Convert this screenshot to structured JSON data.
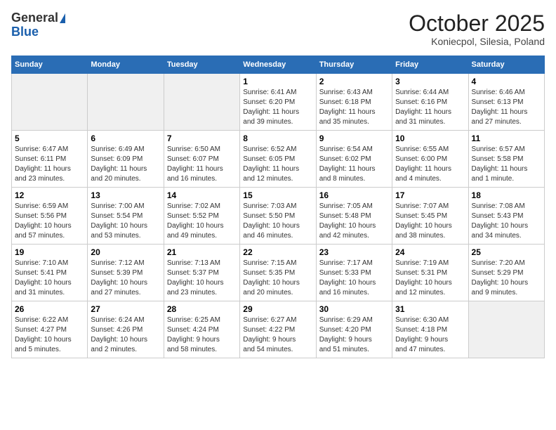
{
  "header": {
    "logo_general": "General",
    "logo_blue": "Blue",
    "month": "October 2025",
    "location": "Koniecpol, Silesia, Poland"
  },
  "weekdays": [
    "Sunday",
    "Monday",
    "Tuesday",
    "Wednesday",
    "Thursday",
    "Friday",
    "Saturday"
  ],
  "weeks": [
    [
      {
        "day": "",
        "detail": ""
      },
      {
        "day": "",
        "detail": ""
      },
      {
        "day": "",
        "detail": ""
      },
      {
        "day": "1",
        "detail": "Sunrise: 6:41 AM\nSunset: 6:20 PM\nDaylight: 11 hours\nand 39 minutes."
      },
      {
        "day": "2",
        "detail": "Sunrise: 6:43 AM\nSunset: 6:18 PM\nDaylight: 11 hours\nand 35 minutes."
      },
      {
        "day": "3",
        "detail": "Sunrise: 6:44 AM\nSunset: 6:16 PM\nDaylight: 11 hours\nand 31 minutes."
      },
      {
        "day": "4",
        "detail": "Sunrise: 6:46 AM\nSunset: 6:13 PM\nDaylight: 11 hours\nand 27 minutes."
      }
    ],
    [
      {
        "day": "5",
        "detail": "Sunrise: 6:47 AM\nSunset: 6:11 PM\nDaylight: 11 hours\nand 23 minutes."
      },
      {
        "day": "6",
        "detail": "Sunrise: 6:49 AM\nSunset: 6:09 PM\nDaylight: 11 hours\nand 20 minutes."
      },
      {
        "day": "7",
        "detail": "Sunrise: 6:50 AM\nSunset: 6:07 PM\nDaylight: 11 hours\nand 16 minutes."
      },
      {
        "day": "8",
        "detail": "Sunrise: 6:52 AM\nSunset: 6:05 PM\nDaylight: 11 hours\nand 12 minutes."
      },
      {
        "day": "9",
        "detail": "Sunrise: 6:54 AM\nSunset: 6:02 PM\nDaylight: 11 hours\nand 8 minutes."
      },
      {
        "day": "10",
        "detail": "Sunrise: 6:55 AM\nSunset: 6:00 PM\nDaylight: 11 hours\nand 4 minutes."
      },
      {
        "day": "11",
        "detail": "Sunrise: 6:57 AM\nSunset: 5:58 PM\nDaylight: 11 hours\nand 1 minute."
      }
    ],
    [
      {
        "day": "12",
        "detail": "Sunrise: 6:59 AM\nSunset: 5:56 PM\nDaylight: 10 hours\nand 57 minutes."
      },
      {
        "day": "13",
        "detail": "Sunrise: 7:00 AM\nSunset: 5:54 PM\nDaylight: 10 hours\nand 53 minutes."
      },
      {
        "day": "14",
        "detail": "Sunrise: 7:02 AM\nSunset: 5:52 PM\nDaylight: 10 hours\nand 49 minutes."
      },
      {
        "day": "15",
        "detail": "Sunrise: 7:03 AM\nSunset: 5:50 PM\nDaylight: 10 hours\nand 46 minutes."
      },
      {
        "day": "16",
        "detail": "Sunrise: 7:05 AM\nSunset: 5:48 PM\nDaylight: 10 hours\nand 42 minutes."
      },
      {
        "day": "17",
        "detail": "Sunrise: 7:07 AM\nSunset: 5:45 PM\nDaylight: 10 hours\nand 38 minutes."
      },
      {
        "day": "18",
        "detail": "Sunrise: 7:08 AM\nSunset: 5:43 PM\nDaylight: 10 hours\nand 34 minutes."
      }
    ],
    [
      {
        "day": "19",
        "detail": "Sunrise: 7:10 AM\nSunset: 5:41 PM\nDaylight: 10 hours\nand 31 minutes."
      },
      {
        "day": "20",
        "detail": "Sunrise: 7:12 AM\nSunset: 5:39 PM\nDaylight: 10 hours\nand 27 minutes."
      },
      {
        "day": "21",
        "detail": "Sunrise: 7:13 AM\nSunset: 5:37 PM\nDaylight: 10 hours\nand 23 minutes."
      },
      {
        "day": "22",
        "detail": "Sunrise: 7:15 AM\nSunset: 5:35 PM\nDaylight: 10 hours\nand 20 minutes."
      },
      {
        "day": "23",
        "detail": "Sunrise: 7:17 AM\nSunset: 5:33 PM\nDaylight: 10 hours\nand 16 minutes."
      },
      {
        "day": "24",
        "detail": "Sunrise: 7:19 AM\nSunset: 5:31 PM\nDaylight: 10 hours\nand 12 minutes."
      },
      {
        "day": "25",
        "detail": "Sunrise: 7:20 AM\nSunset: 5:29 PM\nDaylight: 10 hours\nand 9 minutes."
      }
    ],
    [
      {
        "day": "26",
        "detail": "Sunrise: 6:22 AM\nSunset: 4:27 PM\nDaylight: 10 hours\nand 5 minutes."
      },
      {
        "day": "27",
        "detail": "Sunrise: 6:24 AM\nSunset: 4:26 PM\nDaylight: 10 hours\nand 2 minutes."
      },
      {
        "day": "28",
        "detail": "Sunrise: 6:25 AM\nSunset: 4:24 PM\nDaylight: 9 hours\nand 58 minutes."
      },
      {
        "day": "29",
        "detail": "Sunrise: 6:27 AM\nSunset: 4:22 PM\nDaylight: 9 hours\nand 54 minutes."
      },
      {
        "day": "30",
        "detail": "Sunrise: 6:29 AM\nSunset: 4:20 PM\nDaylight: 9 hours\nand 51 minutes."
      },
      {
        "day": "31",
        "detail": "Sunrise: 6:30 AM\nSunset: 4:18 PM\nDaylight: 9 hours\nand 47 minutes."
      },
      {
        "day": "",
        "detail": ""
      }
    ]
  ]
}
